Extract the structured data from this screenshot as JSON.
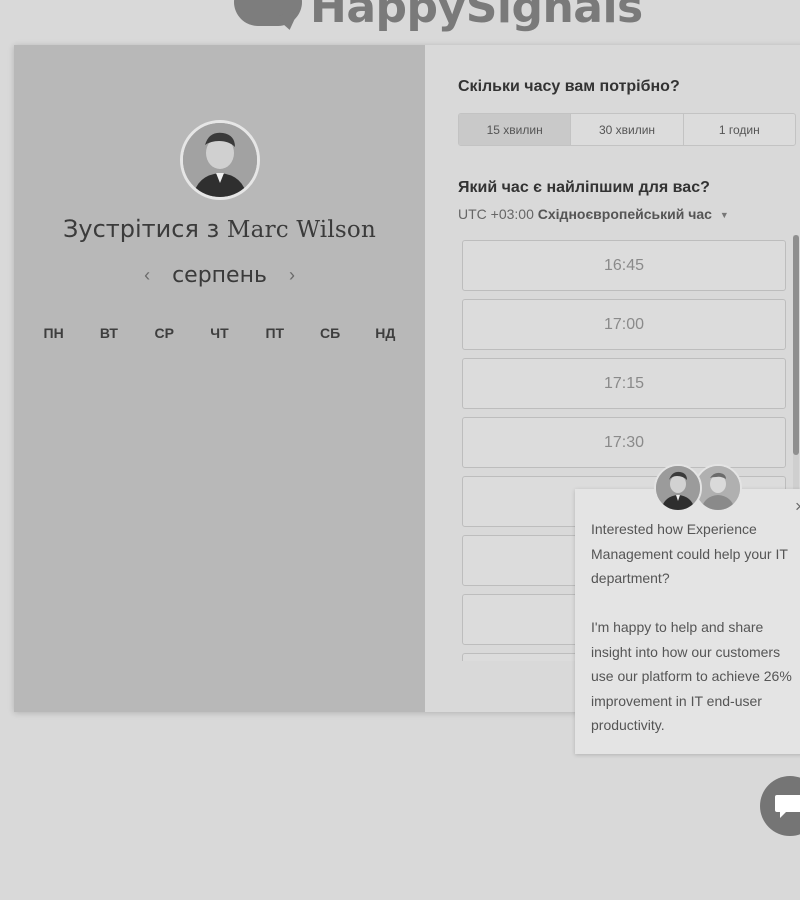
{
  "logo": {
    "text": "HappySignals"
  },
  "host": {
    "meet_prefix": "Зустрітися з",
    "name": "Marc Wilson",
    "avatar_icon": "person-avatar"
  },
  "calendar": {
    "month": "серпень",
    "prev_icon": "chevron-left-icon",
    "next_icon": "chevron-right-icon",
    "weekdays": [
      "ПН",
      "ВТ",
      "СР",
      "ЧТ",
      "ПТ",
      "СБ",
      "НД"
    ]
  },
  "duration": {
    "question": "Скільки часу вам потрібно?",
    "options": [
      "15 хвилин",
      "30 хвилин",
      "1 годин"
    ],
    "selected": "15 хвилин"
  },
  "time": {
    "question": "Який час є найліпшим для вас?",
    "timezone_offset": "UTC +03:00",
    "timezone_name": "Східноєвропейський час",
    "slots": [
      "16:45",
      "17:00",
      "17:15",
      "17:30",
      "",
      "",
      "",
      ""
    ]
  },
  "chat": {
    "message_part1": "Interested how Experience Management could help your IT department?",
    "message_part2": "I'm happy to help and share insight into how our customers use our platform to achieve 26% improvement in IT end-user productivity.",
    "close_label": "×",
    "launcher_icon": "chat-bubble-icon"
  }
}
